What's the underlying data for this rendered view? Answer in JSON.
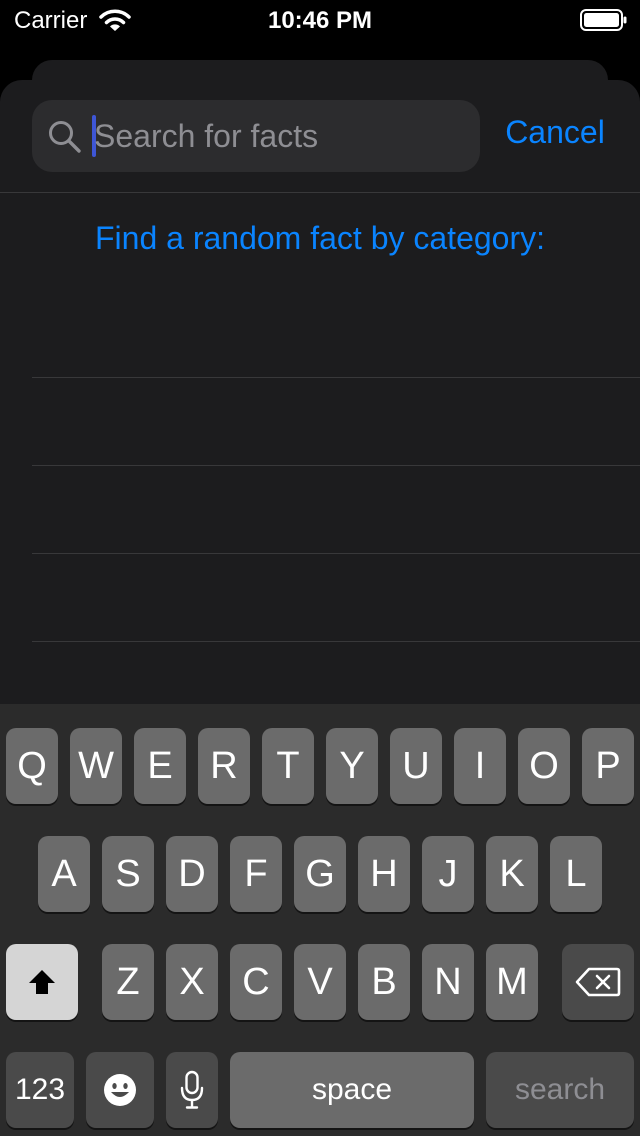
{
  "status_bar": {
    "carrier": "Carrier",
    "time": "10:46 PM"
  },
  "search": {
    "placeholder": "Search for facts",
    "value": "",
    "cancel_label": "Cancel"
  },
  "categories": {
    "header": "Find a random fact by category:",
    "items": [
      "",
      "",
      "",
      "",
      ""
    ]
  },
  "keyboard": {
    "row1": [
      "Q",
      "W",
      "E",
      "R",
      "T",
      "Y",
      "U",
      "I",
      "O",
      "P"
    ],
    "row2": [
      "A",
      "S",
      "D",
      "F",
      "G",
      "H",
      "J",
      "K",
      "L"
    ],
    "row3": [
      "Z",
      "X",
      "C",
      "V",
      "B",
      "N",
      "M"
    ],
    "numbers_label": "123",
    "space_label": "space",
    "search_label": "search"
  },
  "icons": {
    "search": "search-icon",
    "shift": "shift-icon",
    "delete": "delete-icon",
    "emoji": "emoji-icon",
    "microphone": "microphone-icon",
    "wifi": "wifi-icon",
    "battery": "battery-icon"
  },
  "colors": {
    "accent": "#0a84ff",
    "sheet_background": "#1c1c1e",
    "keyboard_background": "#2b2b2b",
    "key": "#6b6b6b",
    "key_dark": "#4a4a4a",
    "cursor": "#3e56d6"
  }
}
